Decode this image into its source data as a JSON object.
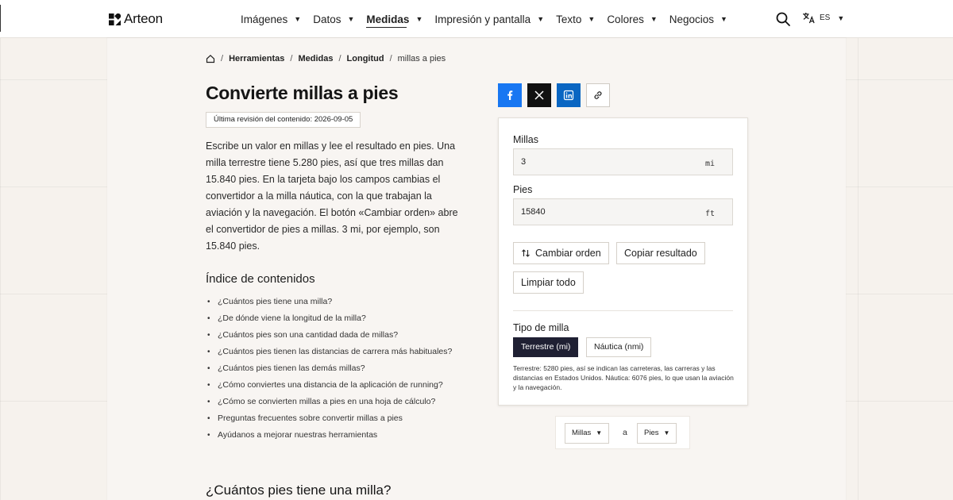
{
  "header": {
    "brand": "Arteon",
    "nav": [
      {
        "label": "Imágenes",
        "active": false
      },
      {
        "label": "Datos",
        "active": false
      },
      {
        "label": "Medidas",
        "active": true
      },
      {
        "label": "Impresión y pantalla",
        "active": false
      },
      {
        "label": "Texto",
        "active": false
      },
      {
        "label": "Colores",
        "active": false
      },
      {
        "label": "Negocios",
        "active": false
      }
    ],
    "lang": "ES",
    "search_icon": "search-icon",
    "lang_icon": "translate-icon"
  },
  "breadcrumb": {
    "home_icon": "home-icon",
    "items": [
      "Herramientas",
      "Medidas",
      "Longitud"
    ],
    "current": "millas a pies"
  },
  "article": {
    "title": "Convierte millas a pies",
    "revision": "Última revisión del contenido: 2026-09-05",
    "intro": "Escribe un valor en millas y lee el resultado en pies. Una milla terrestre tiene 5.280 pies, así que tres millas dan 15.840 pies. En la tarjeta bajo los campos cambias el convertidor a la milla náutica, con la que trabajan la aviación y la navegación. El botón «Cambiar orden» abre el convertidor de pies a millas. 3 mi, por ejemplo, son 15.840 pies.",
    "toc_title": "Índice de contenidos",
    "toc": [
      "¿Cuántos pies tiene una milla?",
      "¿De dónde viene la longitud de la milla?",
      "¿Cuántos pies son una cantidad dada de millas?",
      "¿Cuántos pies tienen las distancias de carrera más habituales?",
      "¿Cuántos pies tienen las demás millas?",
      "¿Cómo conviertes una distancia de la aplicación de running?",
      "¿Cómo se convierten millas a pies en una hoja de cálculo?",
      "Preguntas frecuentes sobre convertir millas a pies",
      "Ayúdanos a mejorar nuestras herramientas"
    ],
    "section_title": "¿Cuántos pies tiene una milla?"
  },
  "share": {
    "facebook_icon": "facebook-icon",
    "x_icon": "x-icon",
    "linkedin_icon": "linkedin-icon",
    "link_icon": "link-icon",
    "colors": {
      "facebook": "#1877f2",
      "x": "#111111",
      "linkedin": "#0a66c2"
    }
  },
  "converter": {
    "from_label": "Millas",
    "from_value": "3",
    "from_unit": "mi",
    "to_label": "Pies",
    "to_value": "15840",
    "to_unit": "ft",
    "swap_label": "Cambiar orden",
    "copy_label": "Copiar resultado",
    "clear_label": "Limpiar todo",
    "mile_type_label": "Tipo de milla",
    "mile_types": [
      {
        "label": "Terrestre (mi)",
        "active": true
      },
      {
        "label": "Náutica (nmi)",
        "active": false
      }
    ],
    "note": "Terrestre: 5280 pies, así se indican las carreteras, las carreras y las distancias en Estados Unidos. Náutica: 6076 pies, lo que usan la aviación y la navegación.",
    "accent": "#1f2033"
  },
  "unit_selector": {
    "from": "Millas",
    "connector": "a",
    "to": "Pies"
  }
}
